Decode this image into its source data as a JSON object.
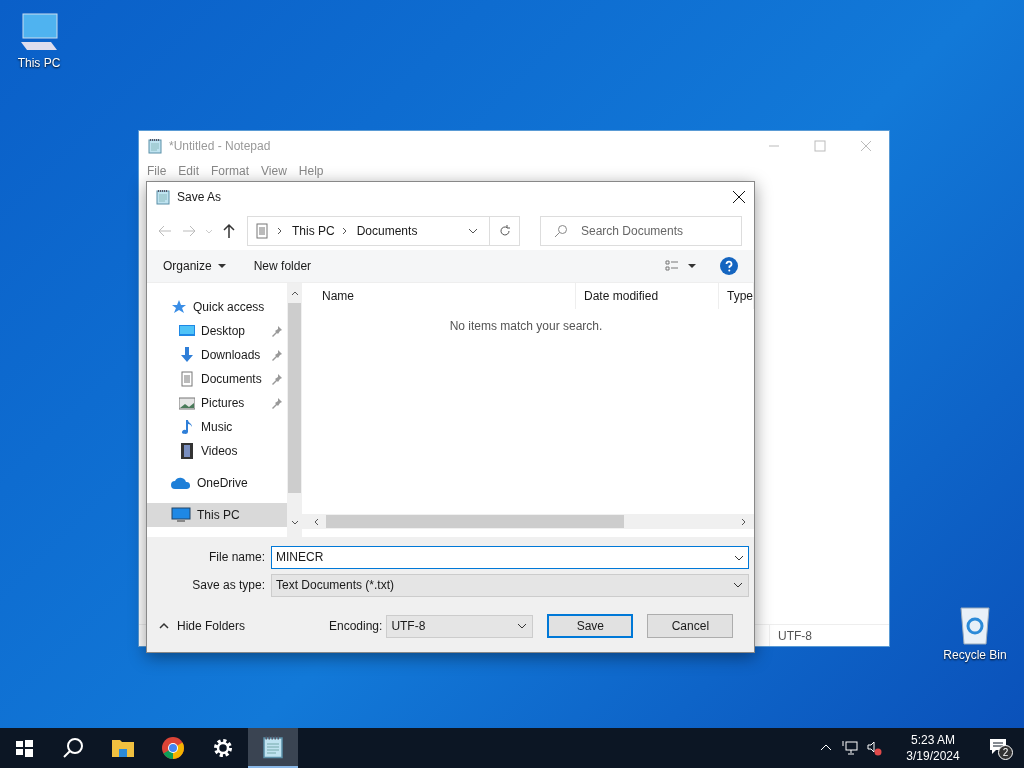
{
  "desktop_icons": [
    {
      "label": "This PC",
      "kind": "computer"
    },
    {
      "label": "Recycle Bin",
      "kind": "bin"
    }
  ],
  "notepad": {
    "title": "*Untitled - Notepad",
    "menu": [
      "File",
      "Edit",
      "Format",
      "View",
      "Help"
    ],
    "status_encoding": "UTF-8"
  },
  "dialog": {
    "title": "Save As",
    "breadcrumb": [
      "This PC",
      "Documents"
    ],
    "search": {
      "placeholder": "Search Documents"
    },
    "toolbar": {
      "organize": "Organize",
      "new_folder": "New folder"
    },
    "nav_items": [
      {
        "label": "Quick access",
        "kind": "star",
        "pinned": false,
        "selected": false,
        "children": [
          {
            "label": "Desktop",
            "kind": "desktop",
            "pinned": true,
            "selected": false
          },
          {
            "label": "Downloads",
            "kind": "download",
            "pinned": true,
            "selected": false
          },
          {
            "label": "Documents",
            "kind": "document",
            "pinned": true,
            "selected": false
          },
          {
            "label": "Pictures",
            "kind": "pictures",
            "pinned": true,
            "selected": false
          },
          {
            "label": "Music",
            "kind": "music",
            "pinned": false,
            "selected": false
          },
          {
            "label": "Videos",
            "kind": "video",
            "pinned": false,
            "selected": false
          }
        ]
      },
      {
        "label": "OneDrive",
        "kind": "cloud",
        "pinned": false,
        "selected": false
      },
      {
        "label": "This PC",
        "kind": "computer",
        "pinned": false,
        "selected": true
      }
    ],
    "columns": [
      "Name",
      "Date modified",
      "Type"
    ],
    "empty_message": "No items match your search.",
    "file_name": {
      "label": "File name:",
      "value": "MINECR"
    },
    "save_as_type": {
      "label": "Save as type:",
      "value": "Text Documents (*.txt)"
    },
    "hide_folders": "Hide Folders",
    "encoding": {
      "label": "Encoding:",
      "value": "UTF-8"
    },
    "buttons": [
      "Save",
      "Cancel"
    ]
  },
  "taskbar": {
    "apps": [
      {
        "kind": "search",
        "active": false
      },
      {
        "kind": "folder",
        "active": false
      },
      {
        "kind": "chrome",
        "active": false
      },
      {
        "kind": "settings",
        "active": false
      },
      {
        "kind": "notepad",
        "active": true
      }
    ],
    "time": "5:23 AM",
    "date": "3/19/2024",
    "notifications": "2"
  }
}
